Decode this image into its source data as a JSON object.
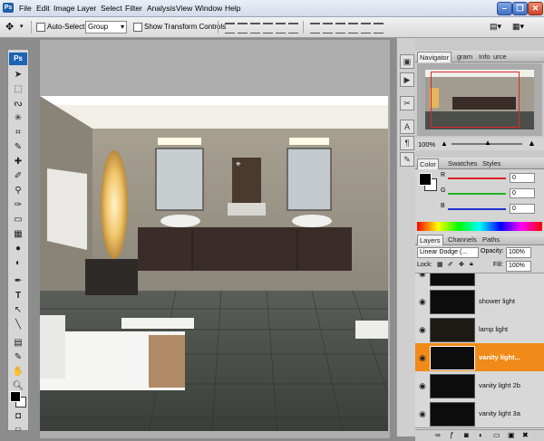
{
  "menubar": {
    "logo": "Ps",
    "items": [
      "File",
      "Edit",
      "Image",
      "Layer",
      "Select",
      "Filter",
      "Analysis",
      "View",
      "Window",
      "Help"
    ]
  },
  "options": {
    "auto_select_label": "Auto-Select:",
    "auto_select_value": "Group",
    "show_transform_label": "Show Transform Controls"
  },
  "toolbox": {
    "badge": "Ps",
    "tools": [
      "move-icon",
      "marquee-icon",
      "lasso-icon",
      "magic-wand-icon",
      "crop-icon",
      "eyedropper-icon",
      "healing-icon",
      "brush-icon",
      "stamp-icon",
      "history-brush-icon",
      "eraser-icon",
      "gradient-icon",
      "blur-icon",
      "dodge-icon",
      "pen-icon",
      "type-icon",
      "path-select-icon",
      "shape-icon",
      "notes-icon",
      "eyedropper2-icon",
      "hand-icon",
      "zoom-icon"
    ]
  },
  "navigator": {
    "tabs": [
      "Navigator",
      "gram",
      "Info",
      "urce"
    ],
    "zoom": "100%"
  },
  "color_panel": {
    "tabs": [
      "Color",
      "Swatches",
      "Styles"
    ],
    "channels": [
      {
        "label": "R",
        "value": "0",
        "color": "#e02020"
      },
      {
        "label": "G",
        "value": "0",
        "color": "#20b020"
      },
      {
        "label": "B",
        "value": "0",
        "color": "#2030d0"
      }
    ]
  },
  "layers_panel": {
    "tabs": [
      "Layers",
      "Channels",
      "Paths"
    ],
    "blend_mode": "Linear Dodge (...",
    "opacity_label": "Opacity:",
    "opacity": "100%",
    "lock_label": "Lock:",
    "fill_label": "Fill:",
    "fill": "100%",
    "layers": [
      {
        "name": "",
        "selected": false
      },
      {
        "name": "shower light",
        "selected": false
      },
      {
        "name": "lamp light",
        "selected": false
      },
      {
        "name": "vanity light...",
        "selected": true
      },
      {
        "name": "vanity light 2b",
        "selected": false
      },
      {
        "name": "vanity light 3a",
        "selected": false
      }
    ]
  },
  "colors": {
    "accent_selected_layer": "#f08a18",
    "photoshop_blue": "#1c64b2"
  }
}
